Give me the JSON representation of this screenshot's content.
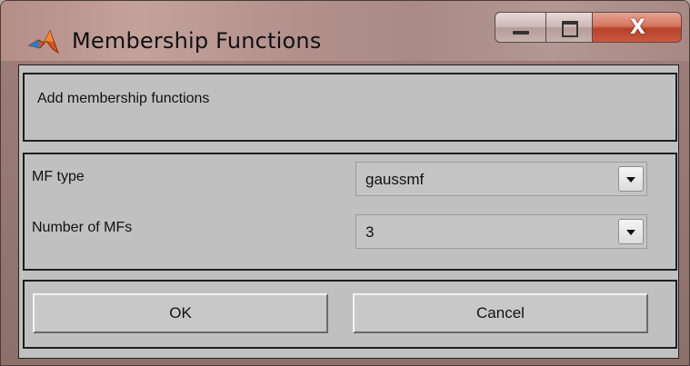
{
  "window": {
    "title": "Membership Functions",
    "app_icon": "matlab-logo-icon",
    "controls": {
      "minimize_icon": "minimize-icon",
      "maximize_icon": "maximize-icon",
      "close_label": "X"
    }
  },
  "header": {
    "text": "Add membership functions"
  },
  "form": {
    "mf_type_label": "MF type",
    "mf_type_value": "gaussmf",
    "num_mfs_label": "Number of MFs",
    "num_mfs_value": "3"
  },
  "buttons": {
    "ok_label": "OK",
    "cancel_label": "Cancel"
  },
  "colors": {
    "panel_background": "#c0c0c0",
    "close_button": "#c85a42"
  }
}
